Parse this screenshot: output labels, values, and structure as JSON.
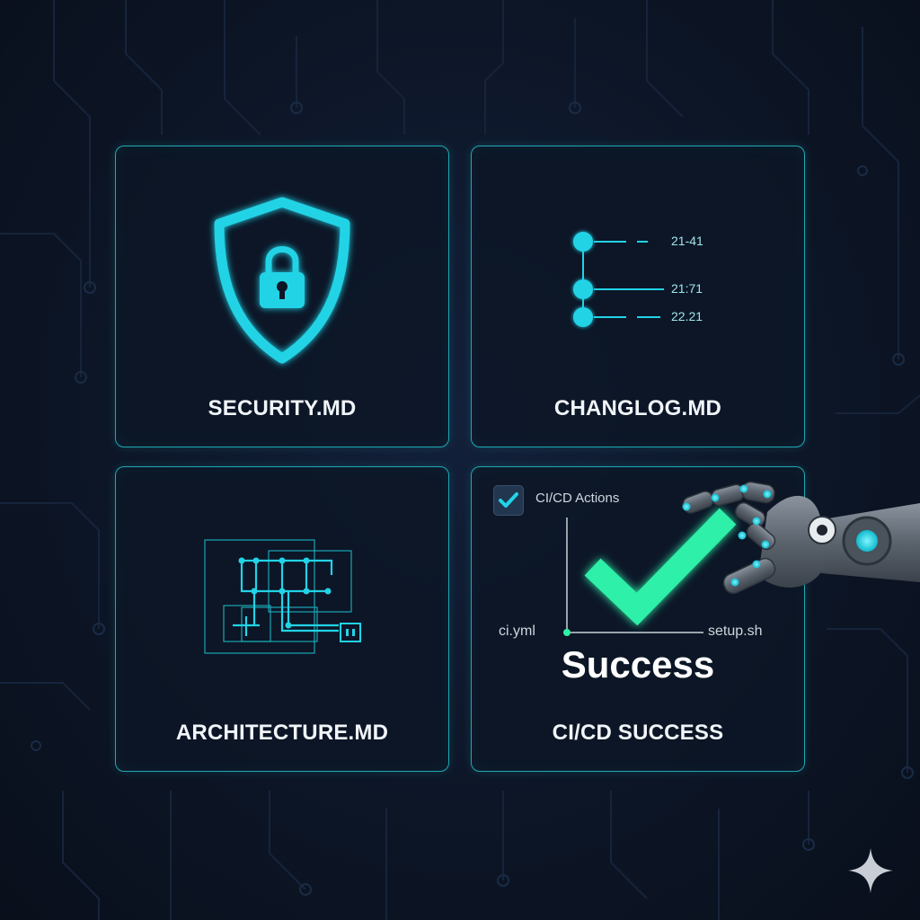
{
  "cards": {
    "security": {
      "label": "SECURITY.MD",
      "icon": "shield-lock-icon"
    },
    "changelog": {
      "label": "CHANGLOG.MD",
      "icon": "timeline-icon",
      "entries": [
        "21-41",
        "21:71",
        "22.21"
      ]
    },
    "architecture": {
      "label": "ARCHITECTURE.MD",
      "icon": "circuit-diagram-icon"
    },
    "cicd": {
      "label": "CI/CD SUCCESS",
      "actions_label": "CI/CD Actions",
      "left_file": "ci.yml",
      "right_file": "setup.sh",
      "status": "Success",
      "icon": "checkmark-icon"
    }
  },
  "decor": {
    "robot_hand": "robot-hand-icon",
    "sparkle": "sparkle-icon"
  },
  "colors": {
    "accent": "#22d3e6",
    "success": "#2ff0a8",
    "border": "#1ea9b4",
    "background": "#0c1220"
  }
}
